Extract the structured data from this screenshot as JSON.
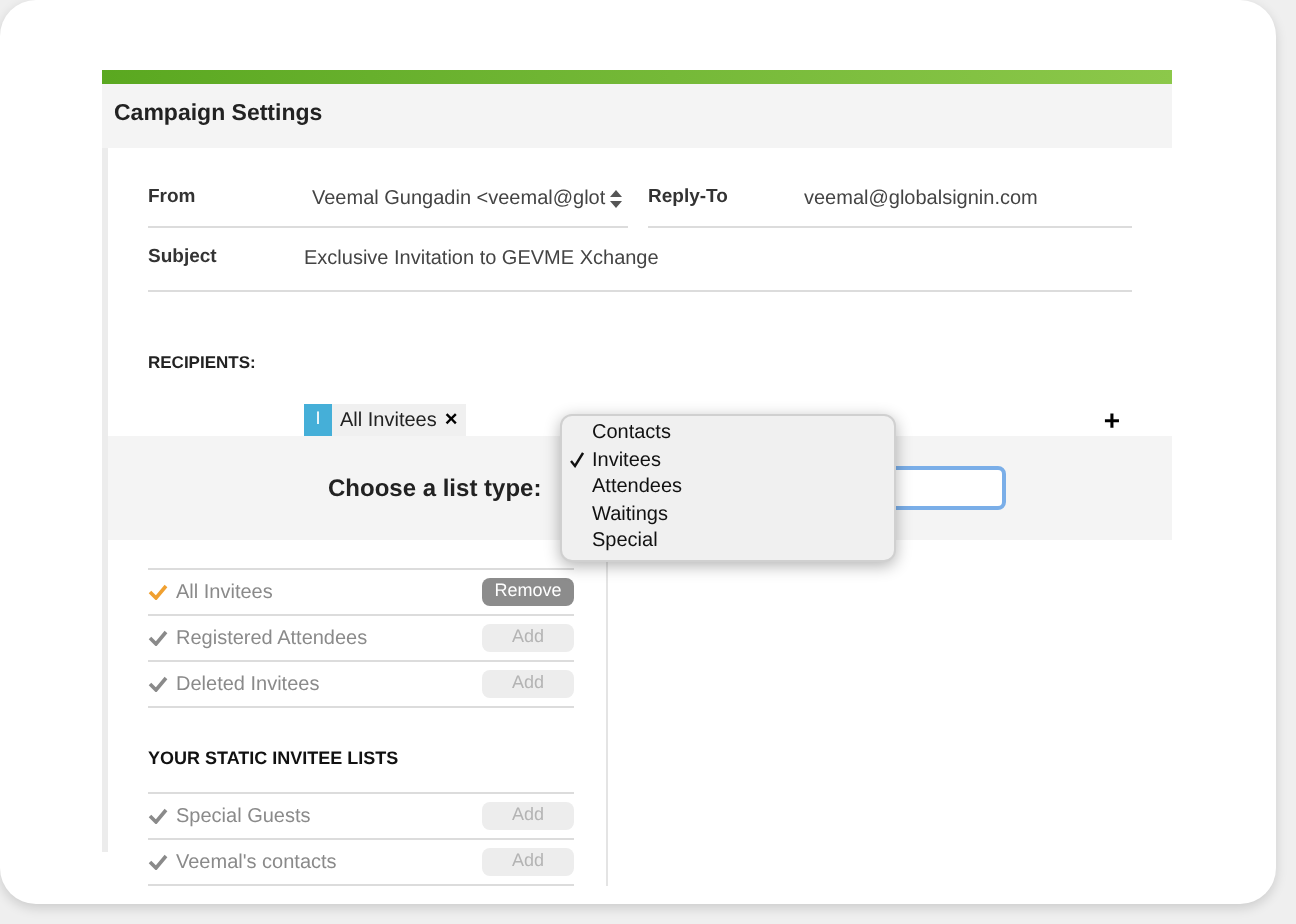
{
  "panel": {
    "title": "Campaign Settings"
  },
  "fields": [
    {
      "label": "From",
      "value": "Veemal Gungadin <veemal@glot"
    },
    {
      "label": "Reply-To",
      "value": "veemal@globalsignin.com"
    },
    {
      "label": "Subject",
      "value": "Exclusive Invitation to GEVME Xchange"
    }
  ],
  "recipients": {
    "label": "RECIPIENTS:",
    "chips": [
      {
        "badge": "I",
        "label": "All Invitees",
        "remove": "×"
      }
    ],
    "add": "+"
  },
  "list_type": {
    "label": "Choose a list type:",
    "options": [
      {
        "label": "Contacts",
        "selected": false
      },
      {
        "label": "Invitees",
        "selected": true
      },
      {
        "label": "Attendees",
        "selected": false
      },
      {
        "label": "Waitings",
        "selected": false
      },
      {
        "label": "Special",
        "selected": false
      }
    ]
  },
  "lists": [
    {
      "label": "All Invitees",
      "selected": true,
      "action": "Remove"
    },
    {
      "label": "Registered Attendees",
      "selected": false,
      "action": "Add"
    },
    {
      "label": "Deleted Invitees",
      "selected": false,
      "action": "Add"
    }
  ],
  "static_lists": {
    "heading": "YOUR STATIC INVITEE LISTS",
    "items": [
      {
        "label": "Special Guests",
        "selected": false,
        "action": "Add"
      },
      {
        "label": "Veemal's contacts",
        "selected": false,
        "action": "Add"
      }
    ]
  }
}
